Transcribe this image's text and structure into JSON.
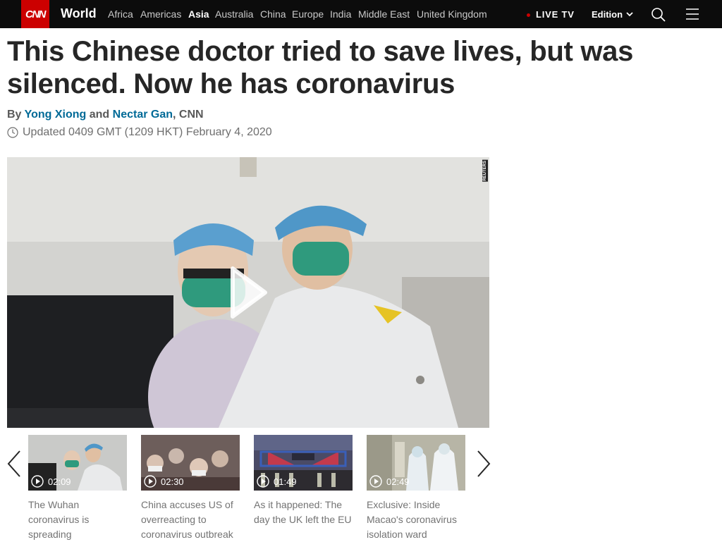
{
  "nav": {
    "logo": "CNN",
    "section": "World",
    "regions": [
      "Africa",
      "Americas",
      "Asia",
      "Australia",
      "China",
      "Europe",
      "India",
      "Middle East",
      "United Kingdom"
    ],
    "active_region": "Asia",
    "live_tv": "LIVE TV",
    "edition": "Edition"
  },
  "article": {
    "headline": "This Chinese doctor tried to save lives, but was silenced. Now he has coronavirus",
    "byline": {
      "by": "By",
      "author1": "Yong Xiong",
      "and": "and",
      "author2": "Nectar Gan",
      "outlet": ", CNN"
    },
    "updated": "Updated 0409 GMT (1209 HKT) February 4, 2020"
  },
  "video": {
    "watermark": "REUTERS"
  },
  "carousel": {
    "items": [
      {
        "duration": "02:09",
        "title": "The Wuhan coronavirus is spreading"
      },
      {
        "duration": "02:30",
        "title": "China accuses US of overreacting to coronavirus outbreak"
      },
      {
        "duration": "01:49",
        "title": "As it happened: The day the UK left the EU"
      },
      {
        "duration": "02:49",
        "title": "Exclusive: Inside Macao's coronavirus isolation ward"
      }
    ]
  },
  "colors": {
    "brand_red": "#cc0000",
    "nav_bg": "#0c0c0c",
    "author_link": "#006a97"
  }
}
